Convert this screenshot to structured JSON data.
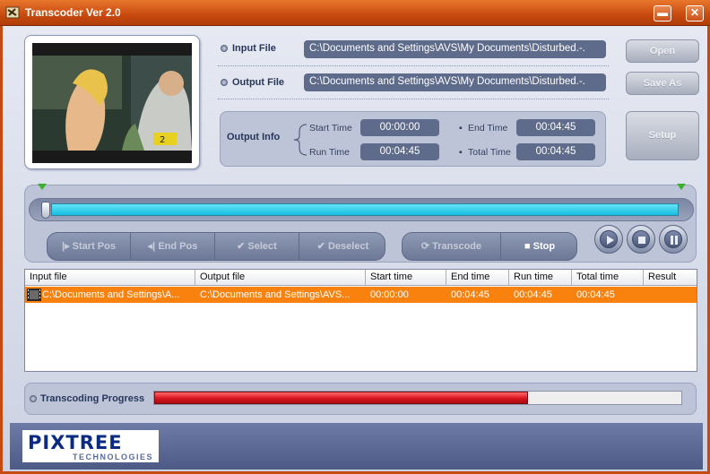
{
  "window": {
    "title": "Transcoder Ver 2.0",
    "minimize_glyph": "▬",
    "close_glyph": "✕"
  },
  "files": {
    "input_label": "Input File",
    "input_value": "C:\\Documents and Settings\\AVS\\My Documents\\Disturbed.-.",
    "output_label": "Output File",
    "output_value": "C:\\Documents and Settings\\AVS\\My Documents\\Disturbed.-.",
    "open_label": "Open",
    "save_as_label": "Save As",
    "setup_label": "Setup"
  },
  "output_info": {
    "label": "Output Info",
    "start_time_label": "Start Time",
    "start_time": "00:00:00",
    "run_time_label": "Run Time",
    "run_time": "00:04:45",
    "end_time_label": "End Time",
    "end_time": "00:04:45",
    "total_time_label": "Total Time",
    "total_time": "00:04:45"
  },
  "timeline": {
    "position_fraction": 0.0,
    "selection_start_fraction": 0.0,
    "selection_end_fraction": 1.0
  },
  "controls": {
    "start_pos": "Start Pos",
    "end_pos": "End Pos",
    "select": "Select",
    "deselect": "Deselect",
    "transcode": "Transcode",
    "stop": "Stop"
  },
  "table": {
    "columns": [
      "Input file",
      "Output file",
      "Start time",
      "End time",
      "Run time",
      "Total time",
      "Result"
    ],
    "rows": [
      {
        "input": "C:\\Documents and Settings\\A...",
        "output": "C:\\Documents and Settings\\AVS...",
        "start": "00:00:00",
        "end": "00:04:45",
        "run": "00:04:45",
        "total": "00:04:45",
        "result": ""
      }
    ]
  },
  "progress": {
    "label": "Transcoding Progress",
    "fraction": 0.71
  },
  "brand": {
    "name": "PIXTREE",
    "tagline": "TECHNOLOGIES"
  },
  "colors": {
    "accent": "#c84a10",
    "progress": "#d8141d",
    "selection": "#f9820e",
    "timeline": "#15bde0"
  }
}
